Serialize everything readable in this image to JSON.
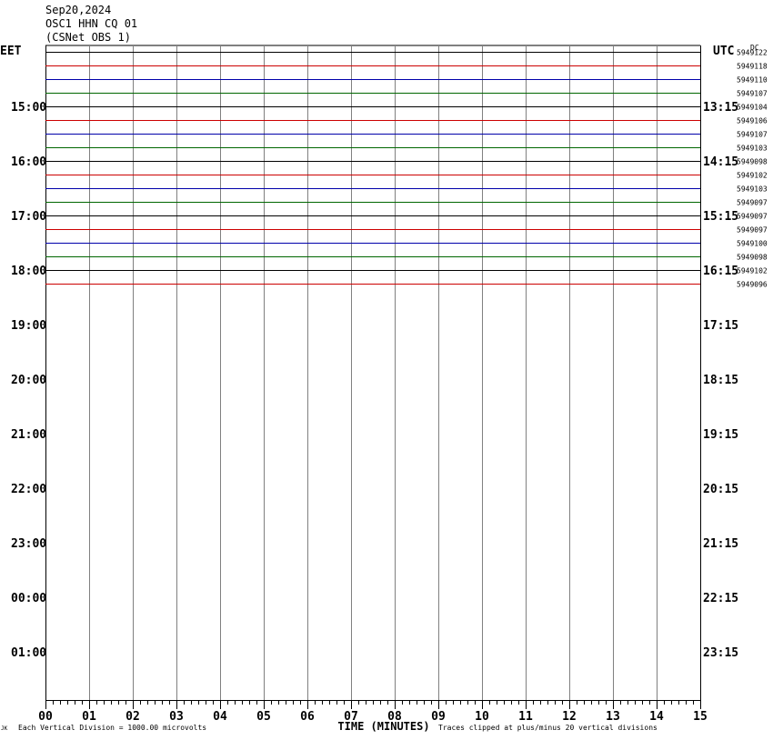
{
  "header": {
    "date": "Sep20,2024",
    "station": "OSC1 HHN CQ 01",
    "network": "(CSNet OBS 1)"
  },
  "tz": {
    "left": "EET",
    "right": "UTC",
    "dc_label": "DC"
  },
  "footer": {
    "scale_note": "Each Vertical Division = 1000.00 microvolts",
    "clip_note": "Traces clipped at plus/minus 20 vertical divisions",
    "corner_mark": "JK"
  },
  "chart_data": {
    "type": "line",
    "title": "",
    "xlabel": "TIME (MINUTES)",
    "ylabel": "",
    "xlim": [
      0,
      15
    ],
    "x_ticks": [
      "00",
      "01",
      "02",
      "03",
      "04",
      "05",
      "06",
      "07",
      "08",
      "09",
      "10",
      "11",
      "12",
      "13",
      "14",
      "15"
    ],
    "grid": true,
    "left_time_labels": [
      "15:00",
      "16:00",
      "17:00",
      "18:00",
      "19:00",
      "20:00",
      "21:00",
      "22:00",
      "23:00",
      "00:00",
      "01:00"
    ],
    "right_time_labels": [
      "13:15",
      "14:15",
      "15:15",
      "16:15",
      "17:15",
      "18:15",
      "19:15",
      "20:15",
      "21:15",
      "22:15",
      "23:15"
    ],
    "trace_colors": [
      "#000000",
      "#cc0000",
      "#0000aa",
      "#006600"
    ],
    "traces": [
      {
        "row": 0,
        "dc": "5949122"
      },
      {
        "row": 1,
        "dc": "5949118"
      },
      {
        "row": 2,
        "dc": "5949110"
      },
      {
        "row": 3,
        "dc": "5949107"
      },
      {
        "row": 4,
        "dc": "5949104"
      },
      {
        "row": 5,
        "dc": "5949106"
      },
      {
        "row": 6,
        "dc": "5949107"
      },
      {
        "row": 7,
        "dc": "5949103"
      },
      {
        "row": 8,
        "dc": "5949098"
      },
      {
        "row": 9,
        "dc": "5949102"
      },
      {
        "row": 10,
        "dc": "5949103"
      },
      {
        "row": 11,
        "dc": "5949097"
      },
      {
        "row": 12,
        "dc": "5949097"
      },
      {
        "row": 13,
        "dc": "5949097"
      },
      {
        "row": 14,
        "dc": "5949100"
      },
      {
        "row": 15,
        "dc": "5949098"
      },
      {
        "row": 16,
        "dc": "5949102"
      },
      {
        "row": 17,
        "dc": "5949096"
      }
    ]
  }
}
